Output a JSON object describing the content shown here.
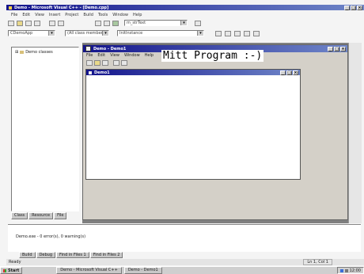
{
  "ide": {
    "title": "Demo - Microsoft Visual C++ - [Demo.cpp]",
    "menu": [
      "File",
      "Edit",
      "View",
      "Insert",
      "Project",
      "Build",
      "Tools",
      "Window",
      "Help"
    ],
    "combos": {
      "classes": "CDemoApp",
      "members": "(All class members)",
      "functions": "InitInstance",
      "find": "m_strText"
    }
  },
  "workspace": {
    "tree_root": "Demo classes",
    "tabs": [
      "Class",
      "Resource",
      "File"
    ]
  },
  "app_window": {
    "title": "Demo - Demo1",
    "menu": [
      "File",
      "Edit",
      "View",
      "Window",
      "Help"
    ],
    "caption_text": "Mitt Program :-)",
    "child_title": "Demo1"
  },
  "output": {
    "line": "Demo.exe - 0 error(s), 0 warning(s)",
    "tabs": [
      "Build",
      "Debug",
      "Find in Files 1",
      "Find in Files 2"
    ],
    "status": "Ready",
    "position": "Ln 1, Col 1"
  },
  "taskbar": {
    "start": "Start",
    "items": [
      "Demo - Microsoft Visual C++",
      "Demo - Demo1"
    ],
    "clock": "12:00"
  }
}
